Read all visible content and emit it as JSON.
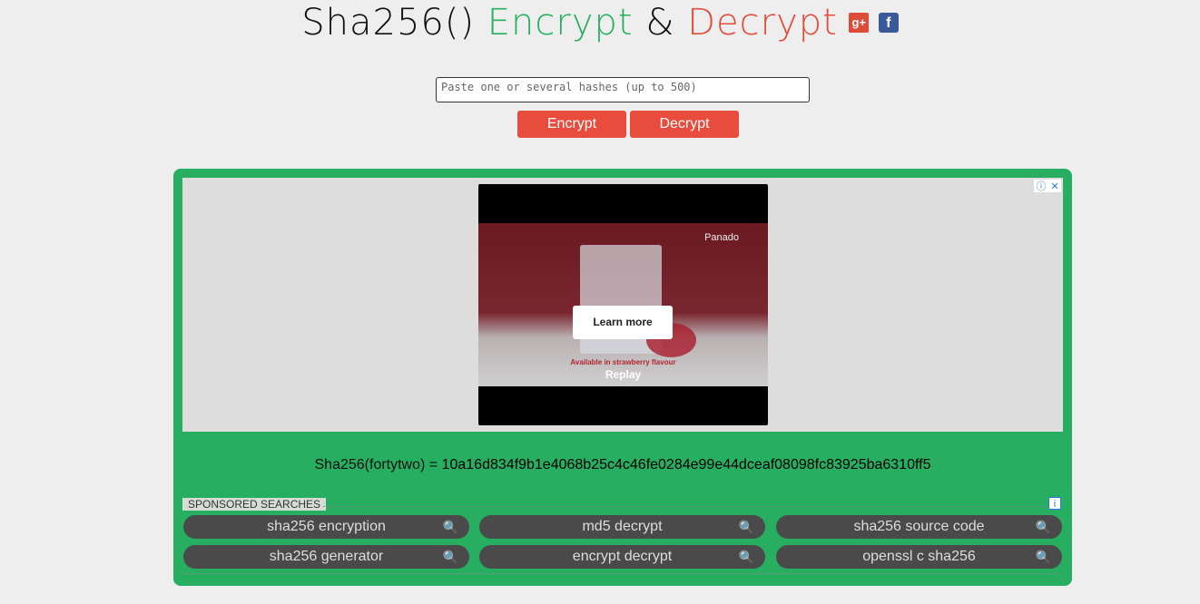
{
  "header": {
    "title_part1": "Sha256()",
    "title_part2": "Encrypt",
    "title_part3": "&",
    "title_part4": "Decrypt",
    "gplus_label": "g+",
    "facebook_label": "f"
  },
  "form": {
    "placeholder": "Paste one or several hashes (up to 500)",
    "encrypt_label": "Encrypt",
    "decrypt_label": "Decrypt"
  },
  "ad": {
    "info_glyph": "ⓘ",
    "close_glyph": "✕",
    "brand": "Panado",
    "tagline": "Available in strawberry flavour",
    "learn_more": "Learn more",
    "replay": "Replay"
  },
  "result": {
    "label": "Sha256(fortytwo) = ",
    "hash": "10a16d834f9b1e4068b25c4c46fe0284e99e44dceaf08098fc83925ba6310ff5"
  },
  "sponsored": {
    "label": "SPONSORED SEARCHES",
    "info_glyph": "i",
    "search_glyph": "🔍",
    "items": [
      {
        "label": "sha256 encryption"
      },
      {
        "label": "md5 decrypt"
      },
      {
        "label": "sha256 source code"
      },
      {
        "label": "sha256 generator"
      },
      {
        "label": "encrypt decrypt"
      },
      {
        "label": "openssl c sha256"
      }
    ]
  },
  "colors": {
    "green": "#27ae60",
    "red": "#e74c3c",
    "background": "#eeeeee"
  }
}
